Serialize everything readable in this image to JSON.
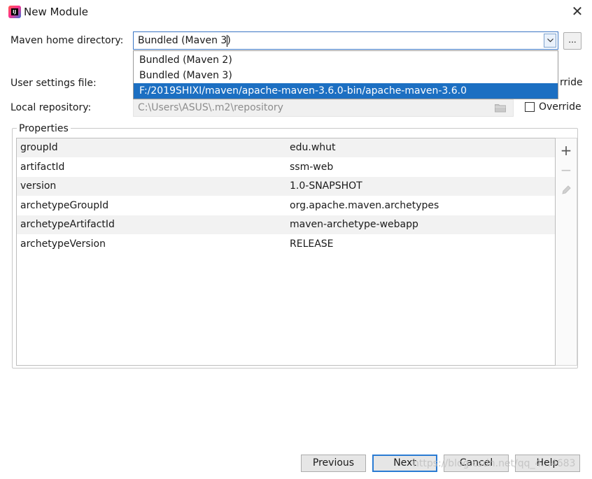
{
  "window": {
    "title": "New Module",
    "close_glyph": "✕"
  },
  "maven_home": {
    "label": "Maven home directory:",
    "value": "Bundled (Maven 3)",
    "ellipsis_label": "...",
    "options": [
      "Bundled (Maven 2)",
      "Bundled (Maven 3)",
      "F:/2019SHIXI/maven/apache-maven-3.6.0-bin/apache-maven-3.6.0"
    ],
    "selected_index": 2
  },
  "user_settings": {
    "label": "User settings file:",
    "override_partial": "rride"
  },
  "local_repository": {
    "label": "Local repository:",
    "value": "C:\\Users\\ASUS\\.m2\\repository",
    "override_label": "Override",
    "override_checked": false
  },
  "properties": {
    "title": "Properties",
    "rows": [
      {
        "key": "groupId",
        "value": "edu.whut"
      },
      {
        "key": "artifactId",
        "value": "ssm-web"
      },
      {
        "key": "version",
        "value": "1.0-SNAPSHOT"
      },
      {
        "key": "archetypeGroupId",
        "value": "org.apache.maven.archetypes"
      },
      {
        "key": "archetypeArtifactId",
        "value": "maven-archetype-webapp"
      },
      {
        "key": "archetypeVersion",
        "value": "RELEASE"
      }
    ],
    "tools": {
      "add": "+",
      "remove": "−"
    }
  },
  "buttons": {
    "previous": "Previous",
    "next": "Next",
    "cancel": "Cancel",
    "help": "Help"
  },
  "watermark": "https://blog.csdn.net/qq_4...4683"
}
